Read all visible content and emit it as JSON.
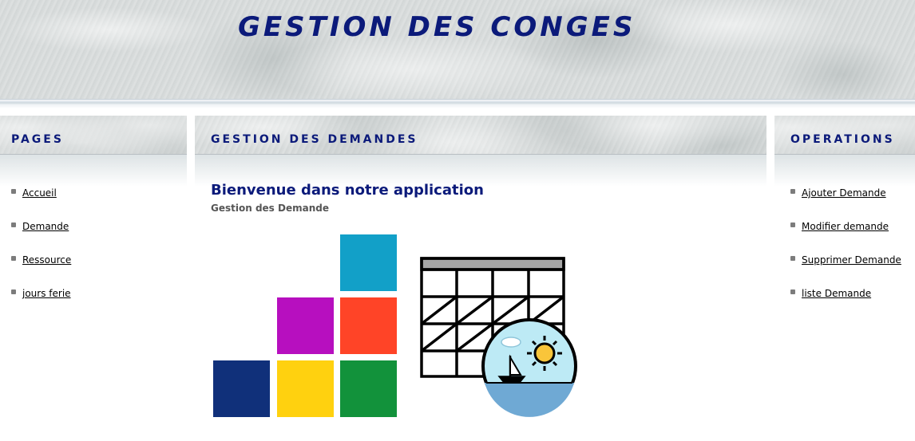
{
  "header": {
    "title": "GESTION DES CONGES"
  },
  "left": {
    "heading": "PAGES",
    "items": [
      {
        "label": "Accueil"
      },
      {
        "label": "Demande"
      },
      {
        "label": "Ressource"
      },
      {
        "label": "jours ferie"
      }
    ]
  },
  "main": {
    "heading": "GESTION DES DEMANDES",
    "welcome": "Bienvenue dans notre application",
    "subtitle": "Gestion des Demande",
    "icons": [
      "tiles-logo-icon",
      "vacation-calendar-icon"
    ],
    "tile_colors": [
      "#12a0c8",
      "#b70fbf",
      "#ff4427",
      "#10307a",
      "#ffd10f",
      "#12923b"
    ]
  },
  "right": {
    "heading": "OPERATIONS",
    "items": [
      {
        "label": "Ajouter Demande"
      },
      {
        "label": "Modifier demande"
      },
      {
        "label": "Supprimer Demande"
      },
      {
        "label": "liste Demande"
      }
    ]
  }
}
